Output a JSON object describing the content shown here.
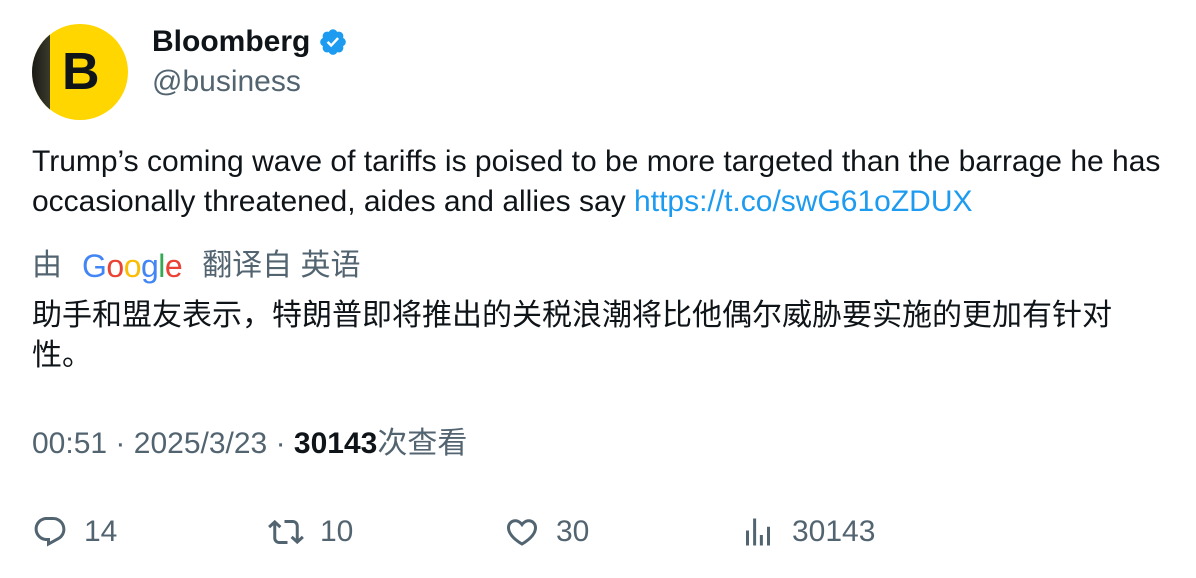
{
  "author": {
    "name": "Bloomberg",
    "handle": "@business",
    "avatar_letter": "B",
    "avatar_color": "#ffd600",
    "verified_color": "#1d9bf0"
  },
  "tweet": {
    "text": "Trump’s coming wave of tariffs is poised to be more targeted than the barrage he has occasionally threatened, aides and allies say ",
    "link": "https://t.co/swG61oZDUX"
  },
  "translation": {
    "prefix": "由",
    "provider": "Google",
    "suffix": "翻译自 英语",
    "text": "助手和盟友表示，特朗普即将推出的关税浪潮将比他偶尔威胁要实施的更加有针对性。"
  },
  "meta": {
    "time": "00:51",
    "separator": "·",
    "date": "2025/3/23",
    "views": "30143",
    "views_label": "次查看"
  },
  "actions": {
    "replies": "14",
    "retweets": "10",
    "likes": "30",
    "views": "30143"
  },
  "colors": {
    "link": "#1d9bf0",
    "muted": "#536471",
    "text": "#0f1419"
  }
}
